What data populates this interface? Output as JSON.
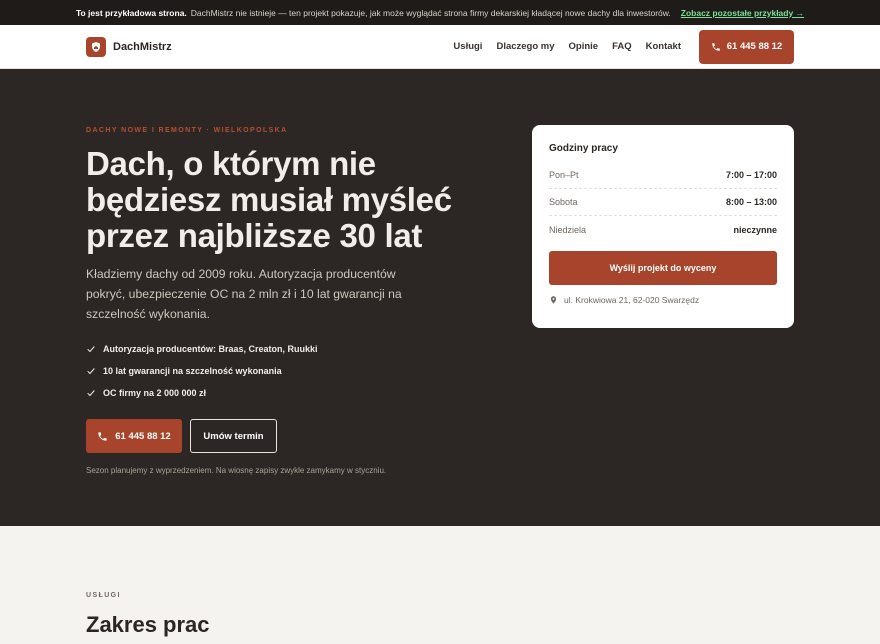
{
  "notice": {
    "bold": "To jest przykładowa strona.",
    "text": "DachMistrz nie istnieje — ten projekt pokazuje, jak może wyglądać strona firmy dekarskiej kładącej nowe dachy dla inwestorów.",
    "link": "Zobacz pozostałe przykłady →"
  },
  "nav": {
    "brand": "DachMistrz",
    "menu": [
      "Usługi",
      "Dlaczego my",
      "Opinie",
      "FAQ",
      "Kontakt"
    ],
    "phone": "61 445 88 12"
  },
  "hero": {
    "eyebrow": "DACHY NOWE I REMONTY · WIELKOPOLSKA",
    "title": "Dach, o którym nie będziesz musiał myśleć przez najbliższe 30 lat",
    "lead": "Kładziemy dachy od 2009 roku. Autoryzacja producentów pokryć, ubezpieczenie OC na 2 mln zł i 10 lat gwarancji na szczelność wykonania.",
    "checks": [
      "Autoryzacja producentów: Braas, Creaton, Ruukki",
      "10 lat gwarancji na szczelność wykonania",
      "OC firmy na 2 000 000 zł"
    ],
    "cta_phone": "61 445 88 12",
    "cta_appointment": "Umów termin",
    "note": "Sezon planujemy z wyprzedzeniem. Na wiosnę zapisy zwykle zamykamy w styczniu."
  },
  "hours": {
    "title": "Godziny pracy",
    "rows": [
      {
        "day": "Pon–Pt",
        "time": "7:00 – 17:00"
      },
      {
        "day": "Sobota",
        "time": "8:00 – 13:00"
      },
      {
        "day": "Niedziela",
        "time": "nieczynne"
      }
    ],
    "button": "Wyślij projekt do wyceny",
    "address": "ul. Krokwiowa 21, 62-020 Swarzędz"
  },
  "services": {
    "eyebrow": "USŁUGI",
    "title": "Zakres prac"
  },
  "colors": {
    "accent": "#a8442c",
    "hero_bg": "#2c2724",
    "notice_link": "#7de09a"
  },
  "icons": [
    "shield-home-icon",
    "phone-icon",
    "check-icon",
    "location-pin-icon"
  ]
}
